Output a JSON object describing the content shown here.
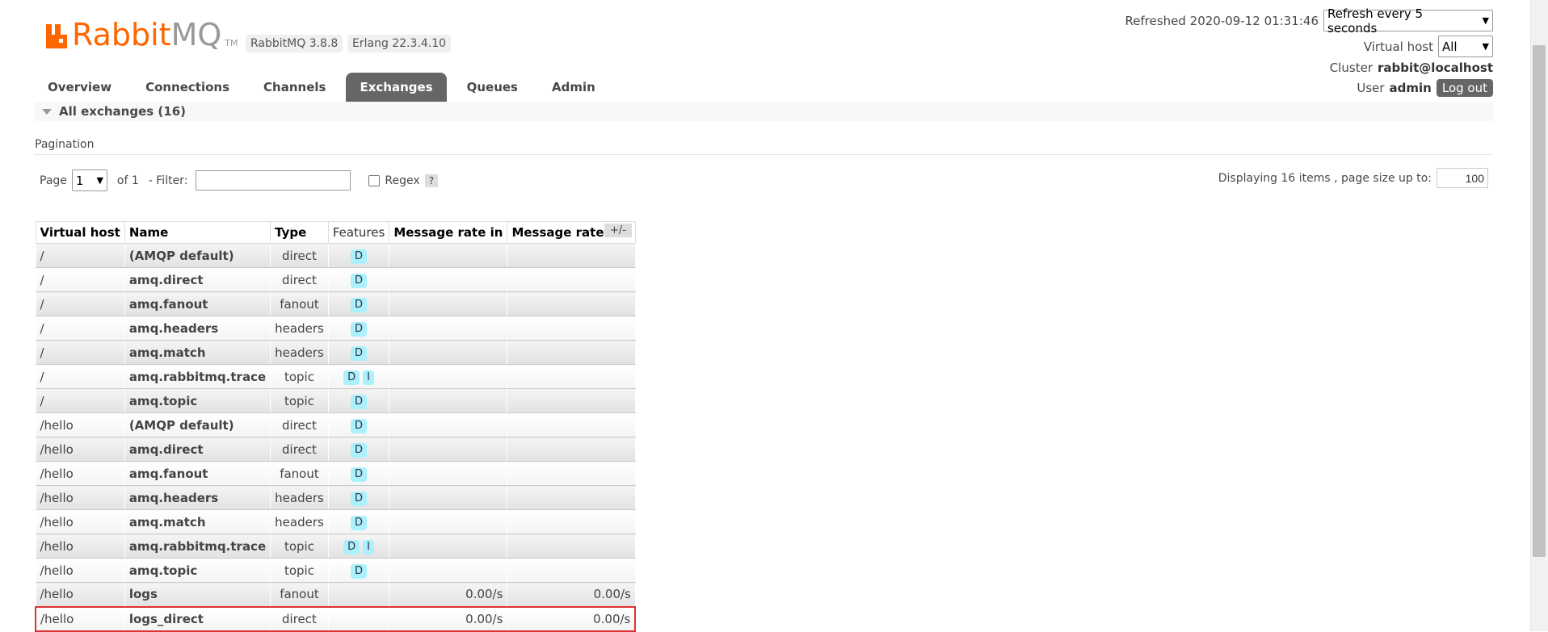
{
  "logo": {
    "rabbit": "Rabbit",
    "mq": "MQ",
    "tm": "TM"
  },
  "versions": {
    "rabbitmq": "RabbitMQ 3.8.8",
    "erlang": "Erlang 22.3.4.10"
  },
  "header": {
    "refreshed_label": "Refreshed 2020-09-12 01:31:46",
    "refresh_select": "Refresh every 5 seconds",
    "vhost_label": "Virtual host",
    "vhost_select": "All",
    "cluster_label": "Cluster",
    "cluster_value": "rabbit@localhost",
    "user_label": "User",
    "user_value": "admin",
    "logout_label": "Log out"
  },
  "tabs": [
    {
      "label": "Overview"
    },
    {
      "label": "Connections"
    },
    {
      "label": "Channels"
    },
    {
      "label": "Exchanges",
      "active": true
    },
    {
      "label": "Queues"
    },
    {
      "label": "Admin"
    }
  ],
  "section": {
    "title": "All exchanges (16)"
  },
  "pagination": {
    "label": "Pagination",
    "page_label": "Page",
    "page_value": "1",
    "of_label": "of 1",
    "filter_label": "- Filter:",
    "filter_value": "",
    "regex_label": "Regex",
    "help_label": "?",
    "displaying_label": "Displaying 16 items , page size up to:",
    "page_size": "100"
  },
  "table": {
    "headers": [
      "Virtual host",
      "Name",
      "Type",
      "Features",
      "Message rate in",
      "Message rate out"
    ],
    "plus_minus": "+/-",
    "rows": [
      {
        "vhost": "/",
        "name": "(AMQP default)",
        "type": "direct",
        "features": [
          "D"
        ],
        "rate_in": "",
        "rate_out": ""
      },
      {
        "vhost": "/",
        "name": "amq.direct",
        "type": "direct",
        "features": [
          "D"
        ],
        "rate_in": "",
        "rate_out": ""
      },
      {
        "vhost": "/",
        "name": "amq.fanout",
        "type": "fanout",
        "features": [
          "D"
        ],
        "rate_in": "",
        "rate_out": ""
      },
      {
        "vhost": "/",
        "name": "amq.headers",
        "type": "headers",
        "features": [
          "D"
        ],
        "rate_in": "",
        "rate_out": ""
      },
      {
        "vhost": "/",
        "name": "amq.match",
        "type": "headers",
        "features": [
          "D"
        ],
        "rate_in": "",
        "rate_out": ""
      },
      {
        "vhost": "/",
        "name": "amq.rabbitmq.trace",
        "type": "topic",
        "features": [
          "D",
          "I"
        ],
        "rate_in": "",
        "rate_out": ""
      },
      {
        "vhost": "/",
        "name": "amq.topic",
        "type": "topic",
        "features": [
          "D"
        ],
        "rate_in": "",
        "rate_out": ""
      },
      {
        "vhost": "/hello",
        "name": "(AMQP default)",
        "type": "direct",
        "features": [
          "D"
        ],
        "rate_in": "",
        "rate_out": ""
      },
      {
        "vhost": "/hello",
        "name": "amq.direct",
        "type": "direct",
        "features": [
          "D"
        ],
        "rate_in": "",
        "rate_out": ""
      },
      {
        "vhost": "/hello",
        "name": "amq.fanout",
        "type": "fanout",
        "features": [
          "D"
        ],
        "rate_in": "",
        "rate_out": ""
      },
      {
        "vhost": "/hello",
        "name": "amq.headers",
        "type": "headers",
        "features": [
          "D"
        ],
        "rate_in": "",
        "rate_out": ""
      },
      {
        "vhost": "/hello",
        "name": "amq.match",
        "type": "headers",
        "features": [
          "D"
        ],
        "rate_in": "",
        "rate_out": ""
      },
      {
        "vhost": "/hello",
        "name": "amq.rabbitmq.trace",
        "type": "topic",
        "features": [
          "D",
          "I"
        ],
        "rate_in": "",
        "rate_out": ""
      },
      {
        "vhost": "/hello",
        "name": "amq.topic",
        "type": "topic",
        "features": [
          "D"
        ],
        "rate_in": "",
        "rate_out": ""
      },
      {
        "vhost": "/hello",
        "name": "logs",
        "type": "fanout",
        "features": [],
        "rate_in": "0.00/s",
        "rate_out": "0.00/s"
      },
      {
        "vhost": "/hello",
        "name": "logs_direct",
        "type": "direct",
        "features": [],
        "rate_in": "0.00/s",
        "rate_out": "0.00/s",
        "highlighted": true
      }
    ]
  },
  "colors": {
    "brand_orange": "#ff6600",
    "tab_active_bg": "#666666",
    "feature_badge": "#aaf0ff",
    "highlight_border": "#dd3333"
  }
}
